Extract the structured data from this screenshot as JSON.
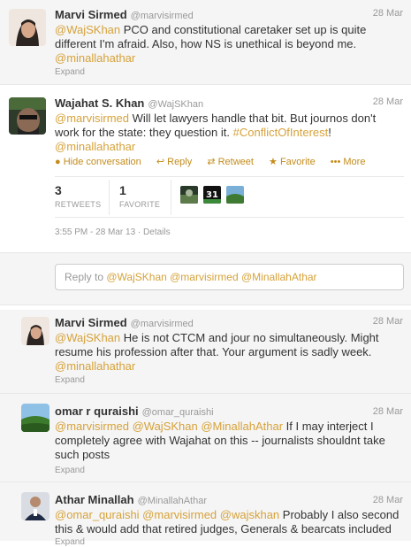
{
  "tweets": [
    {
      "name": "Marvi Sirmed",
      "handle": "@marvisirmed",
      "date": "28 Mar",
      "line1_pre": "@WajSKhan",
      "line1_rest": " PCO and constitutional caretaker set up is quite",
      "line2": "different I'm afraid. Also, how NS is unethical is beyond me.",
      "line3_link": "@minallahathar",
      "expand": "Expand"
    },
    {
      "name": "Wajahat S. Khan",
      "handle": "@WajSKhan",
      "date": "28 Mar",
      "line1_pre": "@marvisirmed",
      "line1_rest": " Will let lawyers handle that bit. But journos don't",
      "line2_pre": "work for the state: they question it. ",
      "line2_link": "#ConflictOfInterest",
      "line2_post": "!",
      "line3_link": "@minallahathar",
      "actions": {
        "hide": "Hide conversation",
        "reply": "Reply",
        "retweet": "Retweet",
        "favorite": "Favorite",
        "more": "More"
      },
      "stats": {
        "retweets_num": "3",
        "retweets_label": "RETWEETS",
        "favorite_num": "1",
        "favorite_label": "FAVORITE"
      },
      "timestamp": "3:55 PM - 28 Mar 13",
      "details": "Details"
    },
    {
      "name": "Marvi Sirmed",
      "handle": "@marvisirmed",
      "date": "28 Mar",
      "line1_pre": "@WajSKhan",
      "line1_rest": " He is not CTCM and jour no simultaneously. Might",
      "line2": "resume his profession after that. Your argument is sadly week.",
      "line3_link": "@minallahathar",
      "expand": "Expand"
    },
    {
      "name": "omar r quraishi",
      "handle": "@omar_quraishi",
      "date": "28 Mar",
      "line1_links": "@marvisirmed @WajSKhan @MinallahAthar",
      "line1_rest": " If I may interject I",
      "line2": "completely agree with Wajahat on this -- journalists shouldnt take",
      "line3": "such posts",
      "expand": "Expand"
    },
    {
      "name": "Athar Minallah",
      "handle": "@MinallahAthar",
      "date": "28 Mar",
      "line1_links": "@omar_quraishi @marvisirmed @wajskhan",
      "line1_rest": " Probably I also second",
      "line2": "this & would add that retired judges, Generals & bearcats included",
      "expand": "Expand"
    }
  ],
  "reply_box": {
    "prefix": "Reply to ",
    "mentions": "@WajSKhan @marvisirmed @MinallahAthar"
  },
  "colors": {
    "link": "#d6a23a",
    "action": "#c38c1c",
    "muted_bg": "#f5f5f5"
  }
}
